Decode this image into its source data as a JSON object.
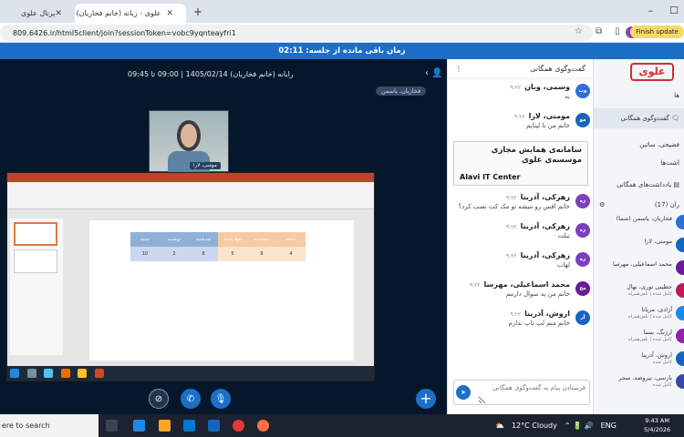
{
  "browser": {
    "tabs": [
      {
        "label": "پرتال علوی"
      },
      {
        "label": "علوی - زبانه (خانم فخاریان) I"
      }
    ],
    "url": "809.6426.ir/html5client/join?sessionToken=vobc9yqnteayfri1",
    "finish_update_label": "Finish update"
  },
  "timer": {
    "label": "زمان باقی مانده از جلسه: 02:11"
  },
  "meeting": {
    "title": "رایانه (خانم فخاریان) 1405/02/14 | 09:00 تا 09:45",
    "presenter_badge": "فخاریان، یاسمن",
    "camera_name": "مومنی، لارا"
  },
  "slide_table": {
    "headers": [
      "شنبه",
      "دوشنبه",
      "سه‌شنبه",
      "چهارشنبه",
      "پنجشنبه",
      "جمعه"
    ],
    "values": [
      "10",
      "2",
      "8",
      "5",
      "9",
      "4"
    ],
    "header_colors": [
      "#8fb1d8",
      "#8fb1d8",
      "#8fb1d8",
      "#f6caa5",
      "#f6caa5",
      "#f6caa5"
    ]
  },
  "chat": {
    "header": "گفت‌وگوی همگانی",
    "messages": [
      {
        "initials": "وب",
        "name": "وسمی، وبان",
        "time": "۹:۲۲",
        "text": "نه",
        "color": "#2e6fd8"
      },
      {
        "initials": "مو",
        "name": "مومنی، لارا",
        "time": "۹:۲۲",
        "text": "خانم من با لپتاپم",
        "color": "#1565c0"
      },
      {
        "initials": "زه",
        "name": "زهرکی، آدرینا",
        "time": "۹:۲۲",
        "text": "خانم افس رو میشه تو مک کت نصب کرد؟",
        "color": "#7b3fbf"
      },
      {
        "initials": "زه",
        "name": "زهرکی، آدرینا",
        "time": "۹:۲۲",
        "text": "تبلت",
        "color": "#7b3fbf"
      },
      {
        "initials": "زه",
        "name": "زهرکی، آدرینا",
        "time": "۹:۲۲",
        "text": "لهاب",
        "color": "#7b3fbf"
      },
      {
        "initials": "مح",
        "name": "محمد اسماعیلی، مهرسا",
        "time": "۹:۲۲",
        "text": "خانم من یه سوال دارمم",
        "color": "#6a1b9a"
      },
      {
        "initials": "آر",
        "name": "اروش، آدرینا",
        "time": "۹:۲۲",
        "text": "خانم منم لپ تاپ ندارم",
        "color": "#1565c0"
      }
    ],
    "system_box": {
      "line1": "سامانه‌ی همایش مجازی",
      "line2": "موسسه‌ی علوی",
      "line3": "Alavi IT Center"
    },
    "input_placeholder": "فرستادن پیام به گفت‌وگوی همگانی"
  },
  "sidebar": {
    "logo": "علوی",
    "section_messages": "ها",
    "public_chat": "گفت‌وگوی همگانی",
    "private_chat": "فضیحی، ساتین",
    "section_notes": "اشت‌ها",
    "shared_notes": "یادداشت‌های همگانی",
    "users_count": "ران (17)",
    "users": [
      {
        "name": "فخاریان، یاسمن (شما)",
        "sub": "",
        "color": "#2e6fd8"
      },
      {
        "name": "مومنی، لارا",
        "sub": "",
        "color": "#1565c0"
      },
      {
        "name": "محمد اسماعیلی، مهرسا",
        "sub": "",
        "color": "#6a1b9a"
      },
      {
        "name": "حظیبی نوری، نهال",
        "sub": "کامل شده | تلفن‌همراه",
        "color": "#c2185b"
      },
      {
        "name": "آزادی، مریانا",
        "sub": "کامل شده | تلفن‌همراه",
        "color": "#1e88e5"
      },
      {
        "name": "ارژنگ، بستا",
        "sub": "کامل شده | تلفن‌همراه",
        "color": "#8e24aa"
      },
      {
        "name": "اروش، آدرینا",
        "sub": "کامل شده",
        "color": "#1565c0"
      },
      {
        "name": "بارسی، نیروضد، سحر",
        "sub": "کامل شده",
        "color": "#3949ab"
      }
    ]
  },
  "taskbar": {
    "search": "ere to search",
    "weather": "12°C  Cloudy",
    "lang": "ENG",
    "time": "9:43 AM",
    "date": "5/4/2026"
  }
}
